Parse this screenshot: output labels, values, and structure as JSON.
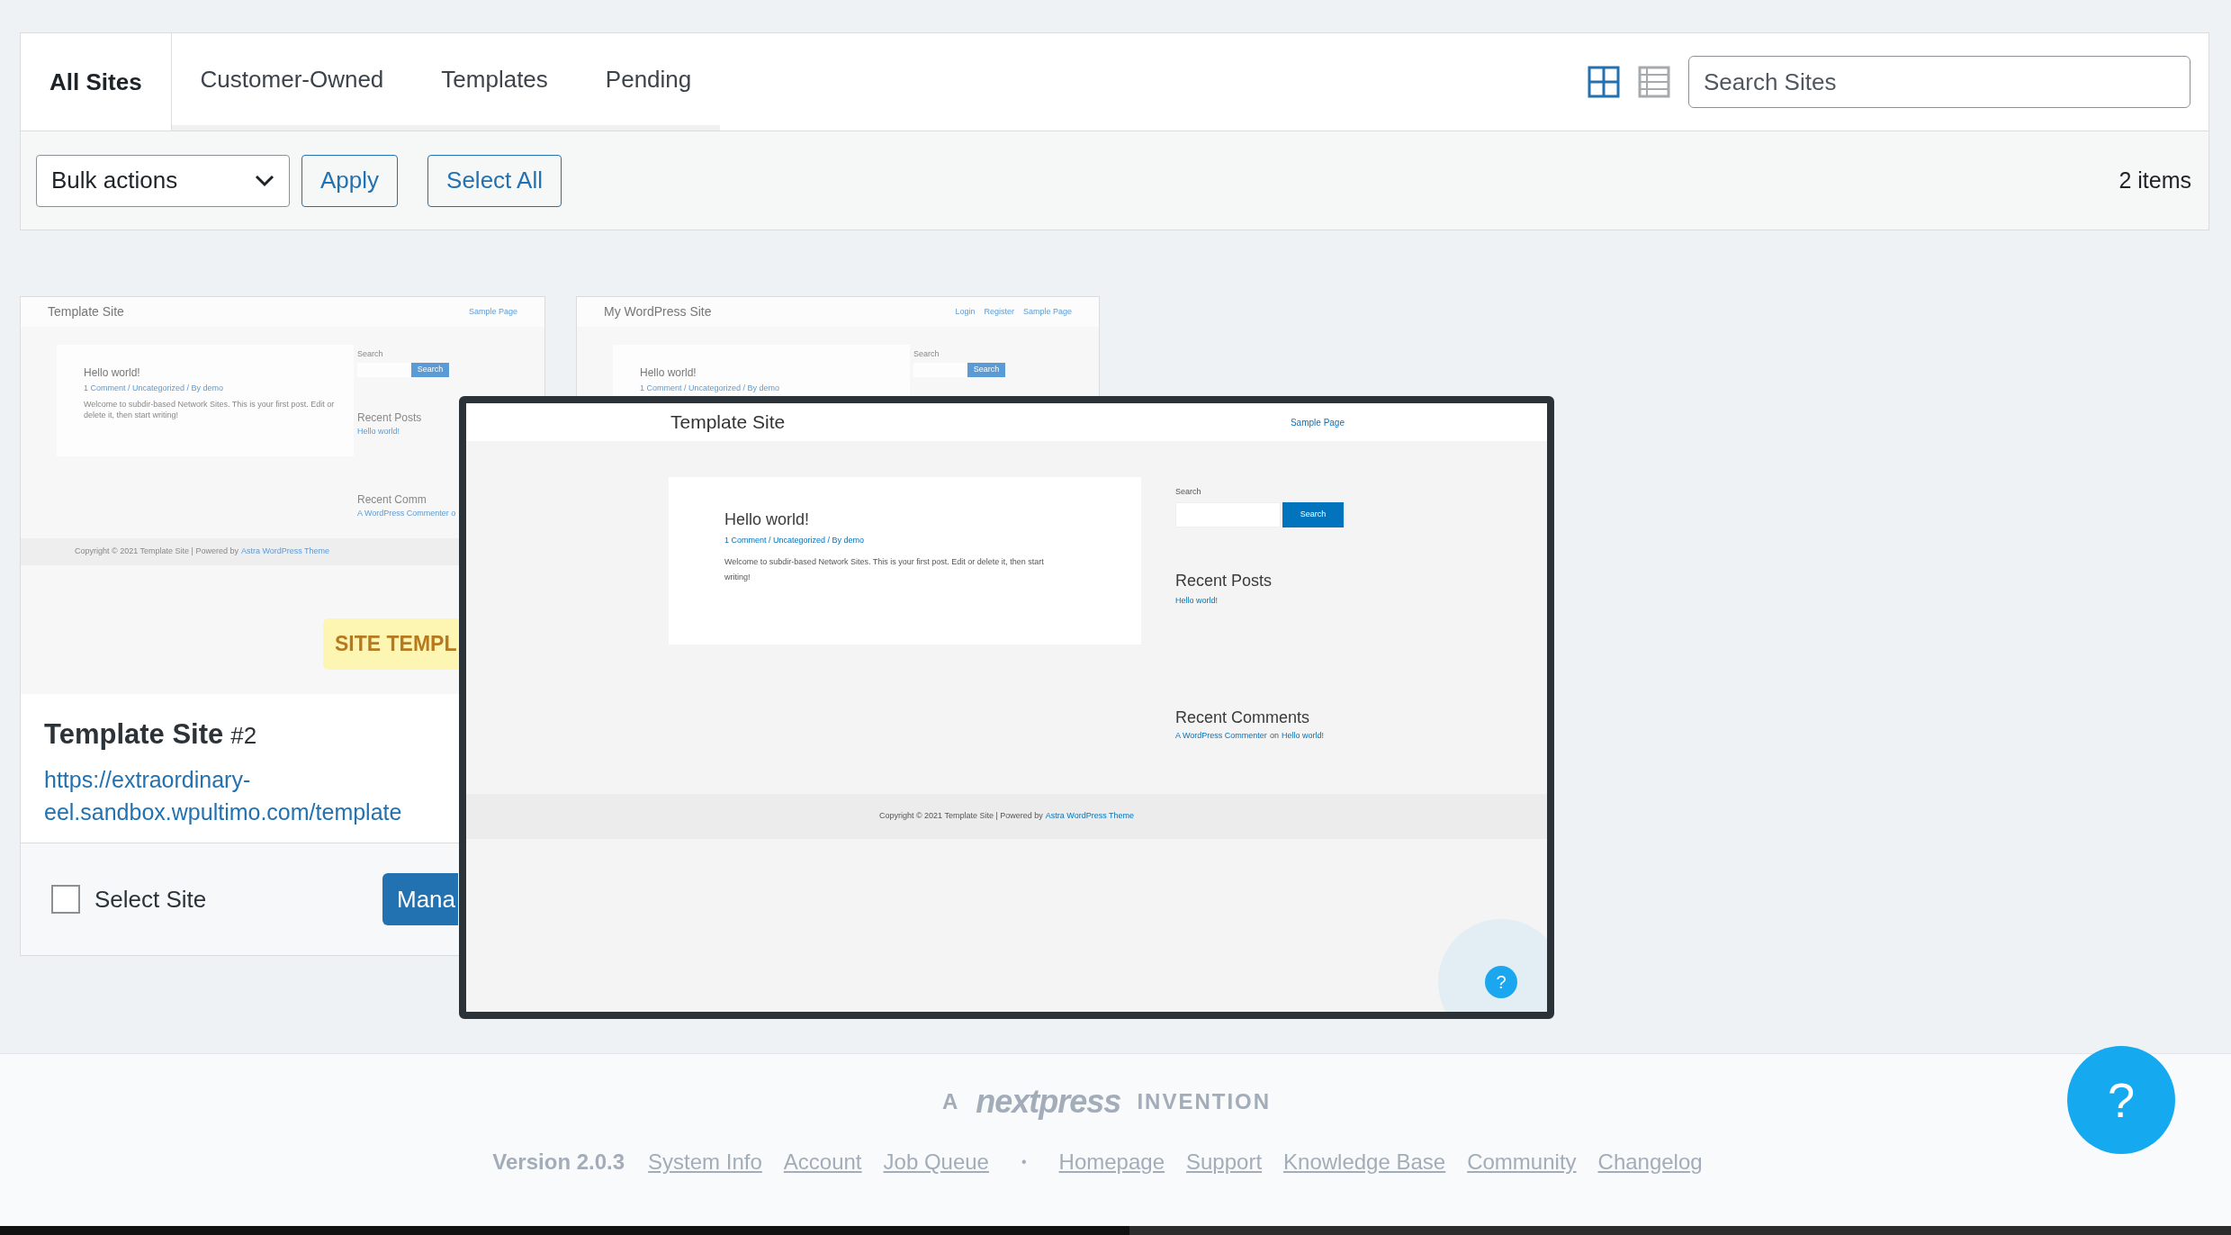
{
  "tabs": [
    {
      "label": "All Sites",
      "selected": true
    },
    {
      "label": "Customer-Owned",
      "selected": false
    },
    {
      "label": "Templates",
      "selected": false
    },
    {
      "label": "Pending",
      "selected": false
    }
  ],
  "view_toggle": [
    {
      "kind": "grid",
      "selected": true
    },
    {
      "kind": "list",
      "selected": false
    }
  ],
  "search": {
    "placeholder": "Search Sites"
  },
  "toolbar": {
    "bulk_actions": "Bulk actions",
    "apply": "Apply",
    "select_all": "Select All",
    "count": "2 items"
  },
  "sites": [
    {
      "kind": "template",
      "thumbnail": {
        "site_title": "Template Site",
        "nav": [
          "Sample Page"
        ],
        "post_title": "Hello world!",
        "post_meta": "1 Comment / Uncategorized / By demo",
        "post_excerpt": "Welcome to subdir-based Network Sites. This is your first post. Edit or delete it, then start writing!",
        "search_label": "Search",
        "search_button": "Search",
        "recent_posts_heading": "Recent Posts",
        "recent_posts": [
          "Hello world!"
        ],
        "recent_comments_heading": "Recent Comm",
        "recent_comment": "A WordPress Commenter o",
        "copyright": "Copyright © 2021 Template Site | Powered by",
        "copyright_link": "Astra WordPress Theme"
      },
      "badge": "SITE TEMPL",
      "title": "Template Site",
      "number": "#2",
      "url": "https://extraordinary-eel.sandbox.wpultimo.com/template",
      "select_label": "Select Site",
      "checked": false,
      "button": "Mana"
    },
    {
      "kind": "site",
      "thumbnail": {
        "site_title": "My WordPress Site",
        "nav": [
          "Login",
          "Register",
          "Sample Page"
        ],
        "post_title": "Hello world!",
        "post_meta": "1 Comment / Uncategorized / By demo",
        "search_label": "Search",
        "search_button": "Search"
      }
    }
  ],
  "preview": {
    "site_title": "Template Site",
    "nav": [
      "Sample Page"
    ],
    "post_title": "Hello world!",
    "post_meta": "1 Comment / Uncategorized / By demo",
    "post_excerpt": "Welcome to subdir-based Network Sites. This is your first post. Edit or delete it, then start writing!",
    "search_label": "Search",
    "search_button": "Search",
    "recent_posts_heading": "Recent Posts",
    "recent_posts": [
      "Hello world!"
    ],
    "recent_comments_heading": "Recent Comments",
    "recent_comment": {
      "author": "A WordPress Commenter",
      "joiner": "on",
      "post": "Hello world!"
    },
    "copyright": "Copyright © 2021 Template Site | Powered by",
    "copyright_link": "Astra WordPress Theme",
    "help": "?"
  },
  "footer": {
    "prefix": "A",
    "brand": "nextpress",
    "suffix": "INVENTION",
    "version": "Version 2.0.3",
    "links_left": [
      "System Info",
      "Account",
      "Job Queue"
    ],
    "separator": "•",
    "links_right": [
      "Homepage",
      "Support",
      "Knowledge Base",
      "Community",
      "Changelog"
    ]
  },
  "help_button": "?"
}
